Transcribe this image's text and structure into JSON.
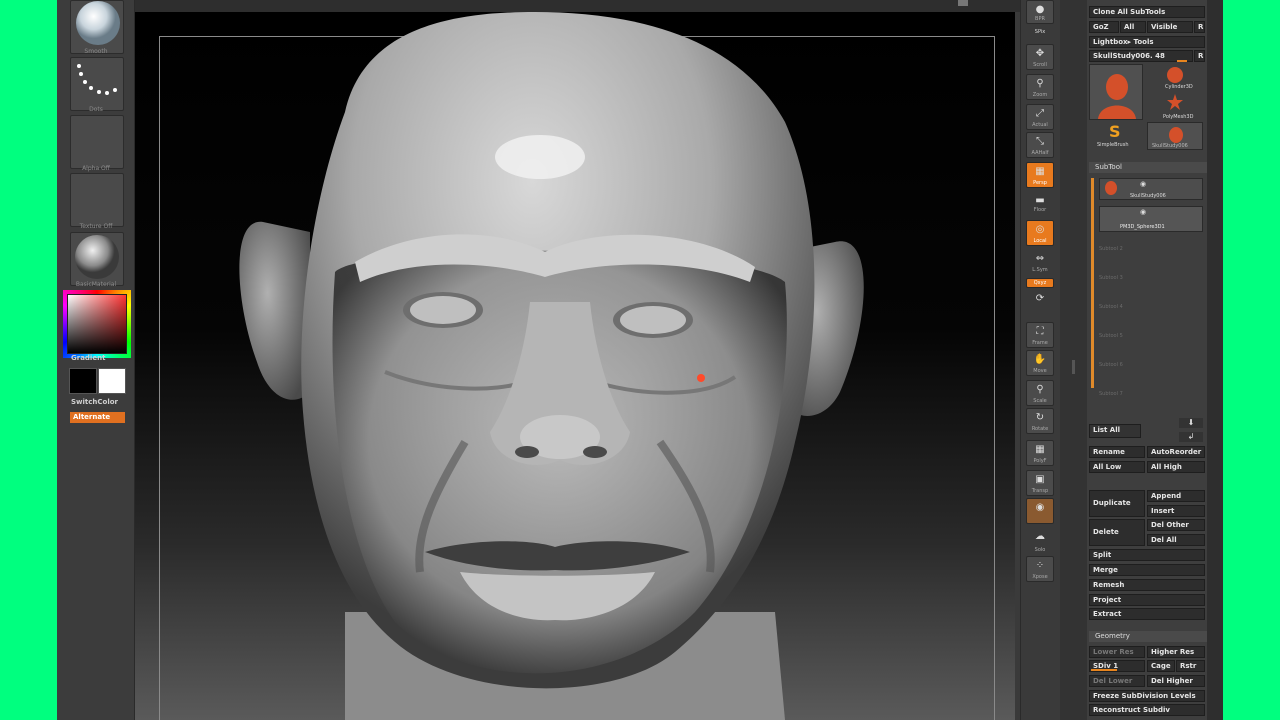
{
  "left_shelf": {
    "brush_label": "Smooth",
    "stroke_label": "Dots",
    "alpha_label": "Alpha Off",
    "texture_label": "Texture Off",
    "material_label": "BasicMaterial",
    "gradient_label": "Gradient",
    "switch_color_label": "SwitchColor",
    "alternate_label": "Alternate"
  },
  "right_nav": [
    {
      "name": "bpr",
      "label": "BPR"
    },
    {
      "name": "spix",
      "label": "SPix"
    },
    {
      "name": "scroll",
      "label": "Scroll"
    },
    {
      "name": "zoom",
      "label": "Zoom"
    },
    {
      "name": "actual",
      "label": "Actual"
    },
    {
      "name": "aahalf",
      "label": "AAHalf"
    },
    {
      "name": "persp",
      "label": "Persp"
    },
    {
      "name": "floor",
      "label": "Floor"
    },
    {
      "name": "local",
      "label": "Local"
    },
    {
      "name": "lsym",
      "label": "L.Sym"
    },
    {
      "name": "xyz",
      "label": "Qxyz"
    },
    {
      "name": "frame",
      "label": "Frame"
    },
    {
      "name": "move",
      "label": "Move"
    },
    {
      "name": "scale",
      "label": "Scale"
    },
    {
      "name": "rotate",
      "label": "Rotate"
    },
    {
      "name": "polyf",
      "label": "PolyF"
    },
    {
      "name": "transp",
      "label": "Transp"
    },
    {
      "name": "ghost",
      "label": "Ghost"
    },
    {
      "name": "solo",
      "label": "Solo"
    },
    {
      "name": "xpose",
      "label": "Xpose"
    }
  ],
  "tool": {
    "clone_all": "Clone All SubTools",
    "goz": "GoZ",
    "all": "All",
    "visible": "Visible",
    "r": "R",
    "lightbox_tools": "Lightbox▸ Tools",
    "current_tool": "SkullStudy006. 48",
    "tools": [
      {
        "name": "SkullStudy006",
        "label": ""
      },
      {
        "name": "Cylinder3D",
        "label": "Cylinder3D"
      },
      {
        "name": "PolyMesh3D",
        "label": "PolyMesh3D"
      },
      {
        "name": "SimpleBrush",
        "label": "SimpleBrush"
      },
      {
        "name": "SkullStudy006-2",
        "label": "SkullStudy006"
      }
    ]
  },
  "subtool": {
    "header": "SubTool",
    "items": [
      {
        "label": "SkullStudy006"
      },
      {
        "label": "PM3D_Sphere3D1"
      }
    ],
    "empty_slots": [
      "Subtool 2",
      "Subtool 3",
      "Subtool 4",
      "Subtool 5",
      "Subtool 6",
      "Subtool 7"
    ],
    "list_all": "List All",
    "rename": "Rename",
    "autoreorder": "AutoReorder",
    "all_low": "All Low",
    "all_high": "All High",
    "duplicate": "Duplicate",
    "append": "Append",
    "insert": "Insert",
    "delete": "Delete",
    "del_other": "Del Other",
    "del_all": "Del All",
    "split": "Split",
    "merge": "Merge",
    "remesh": "Remesh",
    "project": "Project",
    "extract": "Extract"
  },
  "geometry": {
    "header": "Geometry",
    "lower_res": "Lower Res",
    "higher_res": "Higher Res",
    "sdiv": "SDiv 1",
    "cage": "Cage",
    "rstr": "Rstr",
    "del_lower": "Del Lower",
    "del_higher": "Del Higher",
    "freeze": "Freeze SubDivision Levels",
    "reconstruct": "Reconstruct Subdiv"
  },
  "colors": {
    "accent": "#e87a1e",
    "background_green": "#00ff7f",
    "ui_gray": "#3a3a3a"
  }
}
